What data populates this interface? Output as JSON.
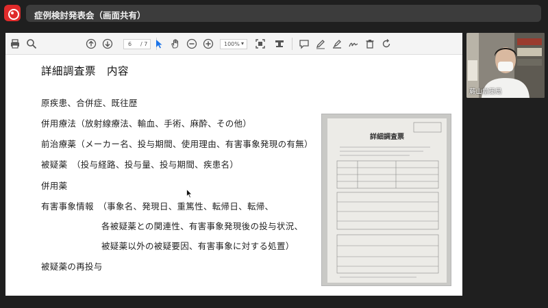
{
  "window": {
    "title": "症例検討発表会（画面共有）"
  },
  "toolbar": {
    "current_page": "6",
    "total_pages": "/ 7",
    "zoom": "100%"
  },
  "slide": {
    "title": "詳細調査票　内容",
    "lines": [
      "原疾患、合併症、既往歴",
      "併用療法（放射線療法、輸血、手術、麻酔、その他）",
      "前治療薬（メーカー名、投与期間、使用理由、有害事象発現の有無）",
      "被疑薬　（投与経路、投与量、投与期間、疾患名）",
      "併用薬",
      "有害事象情報　（事象名、発現日、重篤性、転帰日、転帰、",
      "各被疑薬との関連性、有害事象発現後の投与状況、",
      "被疑薬以外の被疑要因、有害事象に対する処置）",
      "被疑薬の再投与"
    ],
    "document_image_title": "詳細調査票"
  },
  "webcam": {
    "participant_name": "蕨山堂薬局"
  }
}
